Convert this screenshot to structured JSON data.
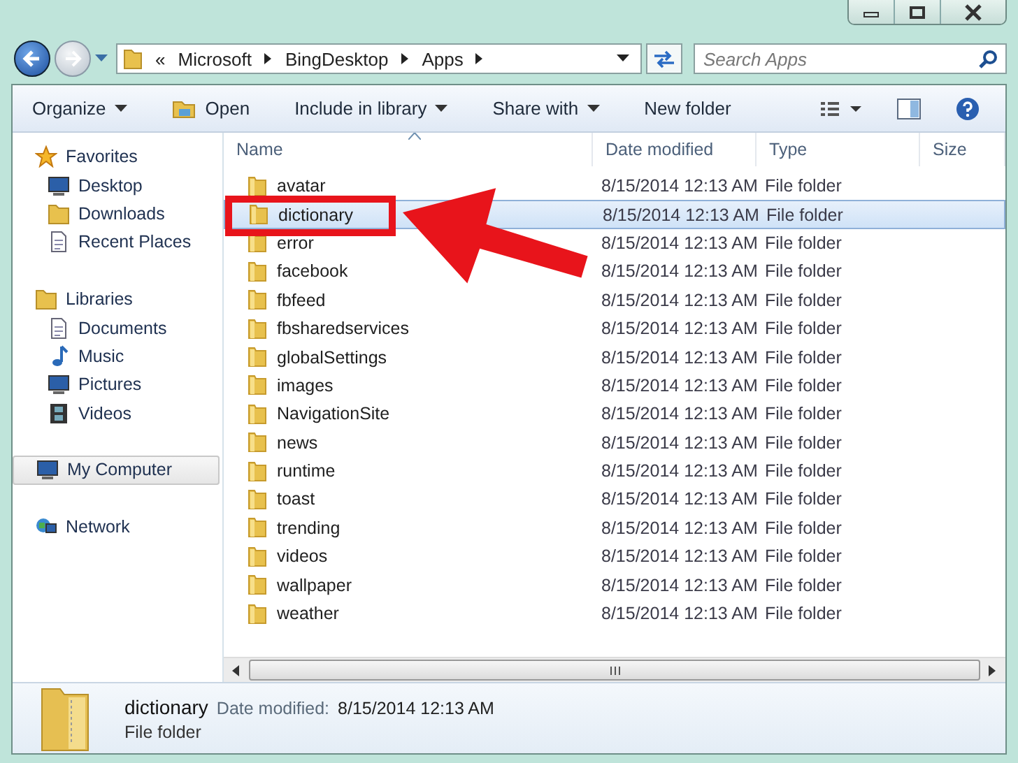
{
  "address_bar": {
    "overflow": "«",
    "crumbs": [
      "Microsoft",
      "BingDesktop",
      "Apps"
    ]
  },
  "search": {
    "placeholder": "Search Apps"
  },
  "toolbar": [
    {
      "label": "Organize",
      "kind": "menu"
    },
    {
      "label": "Open",
      "kind": "open"
    },
    {
      "label": "Include in library",
      "kind": "menu"
    },
    {
      "label": "Share with",
      "kind": "menu"
    },
    {
      "label": "New folder",
      "kind": "plain"
    }
  ],
  "navigation": [
    {
      "label": "Favorites",
      "kind": "favorites",
      "selected": false,
      "children": [
        {
          "label": "Desktop",
          "kind": "desktop",
          "selected": false
        },
        {
          "label": "Downloads",
          "kind": "downloads",
          "selected": false
        },
        {
          "label": "Recent Places",
          "kind": "recent",
          "selected": false
        }
      ]
    },
    {
      "label": "Libraries",
      "kind": "libraries",
      "selected": false,
      "children": [
        {
          "label": "Documents",
          "kind": "documents",
          "selected": false
        },
        {
          "label": "Music",
          "kind": "music",
          "selected": false
        },
        {
          "label": "Pictures",
          "kind": "pictures",
          "selected": false
        },
        {
          "label": "Videos",
          "kind": "videos",
          "selected": false
        }
      ]
    },
    {
      "label": "My Computer",
      "kind": "computer",
      "selected": true
    },
    {
      "label": "Network",
      "kind": "network",
      "selected": false
    }
  ],
  "table": {
    "columns": [
      {
        "label": "Name",
        "sorted": true
      },
      {
        "label": "Date modified",
        "sorted": false
      },
      {
        "label": "Type",
        "sorted": false
      },
      {
        "label": "Size",
        "sorted": false
      }
    ],
    "rows": [
      {
        "name": "avatar",
        "date": "8/15/2014 12:13 AM",
        "type": "File folder",
        "selected": false
      },
      {
        "name": "dictionary",
        "date": "8/15/2014 12:13 AM",
        "type": "File folder",
        "selected": true
      },
      {
        "name": "error",
        "date": "8/15/2014 12:13 AM",
        "type": "File folder",
        "selected": false
      },
      {
        "name": "facebook",
        "date": "8/15/2014 12:13 AM",
        "type": "File folder",
        "selected": false
      },
      {
        "name": "fbfeed",
        "date": "8/15/2014 12:13 AM",
        "type": "File folder",
        "selected": false
      },
      {
        "name": "fbsharedservices",
        "date": "8/15/2014 12:13 AM",
        "type": "File folder",
        "selected": false
      },
      {
        "name": "globalSettings",
        "date": "8/15/2014 12:13 AM",
        "type": "File folder",
        "selected": false
      },
      {
        "name": "images",
        "date": "8/15/2014 12:13 AM",
        "type": "File folder",
        "selected": false
      },
      {
        "name": "NavigationSite",
        "date": "8/15/2014 12:13 AM",
        "type": "File folder",
        "selected": false
      },
      {
        "name": "news",
        "date": "8/15/2014 12:13 AM",
        "type": "File folder",
        "selected": false
      },
      {
        "name": "runtime",
        "date": "8/15/2014 12:13 AM",
        "type": "File folder",
        "selected": false
      },
      {
        "name": "toast",
        "date": "8/15/2014 12:13 AM",
        "type": "File folder",
        "selected": false
      },
      {
        "name": "trending",
        "date": "8/15/2014 12:13 AM",
        "type": "File folder",
        "selected": false
      },
      {
        "name": "videos",
        "date": "8/15/2014 12:13 AM",
        "type": "File folder",
        "selected": false
      },
      {
        "name": "wallpaper",
        "date": "8/15/2014 12:13 AM",
        "type": "File folder",
        "selected": false
      },
      {
        "name": "weather",
        "date": "8/15/2014 12:13 AM",
        "type": "File folder",
        "selected": false
      }
    ]
  },
  "details": {
    "name": "dictionary",
    "date_label": "Date modified:",
    "date": "8/15/2014 12:13 AM",
    "type": "File folder"
  }
}
